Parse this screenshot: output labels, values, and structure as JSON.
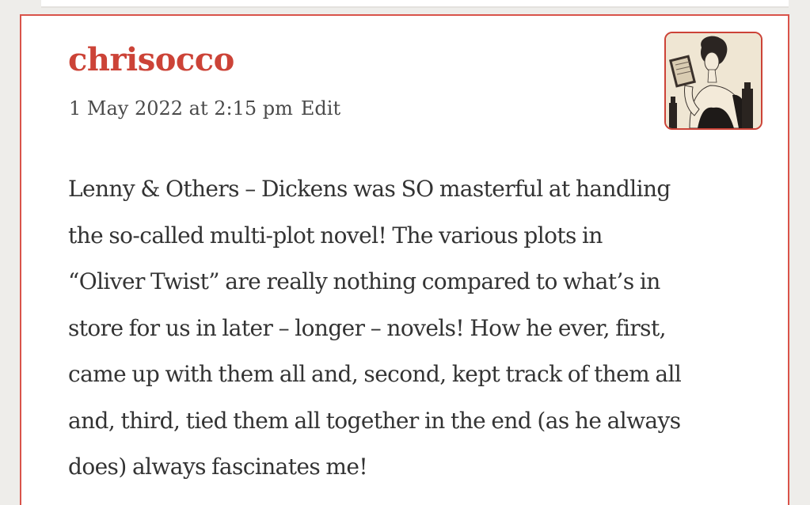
{
  "comment": {
    "author": "chrisocco",
    "date": "1 May 2022 at 2:15 pm",
    "edit_label": "Edit",
    "avatar_icon": "portrait-avatar-icon",
    "lines": [
      "Lenny & Others – Dickens was SO masterful at handling",
      "the so-called multi-plot novel! The various plots in",
      "“Oliver Twist” are really nothing compared to what’s in",
      "store for us in later – longer – novels! How he ever, first,",
      "came up with them all and, second, kept track of them all",
      "and, third, tied them all together in the end (as he always",
      "does) always fascinates me!"
    ]
  },
  "colors": {
    "accent": "#cc4337",
    "text": "#333333",
    "meta": "#4a4a4a",
    "page_background": "#eeedea",
    "card_background": "#ffffff"
  }
}
